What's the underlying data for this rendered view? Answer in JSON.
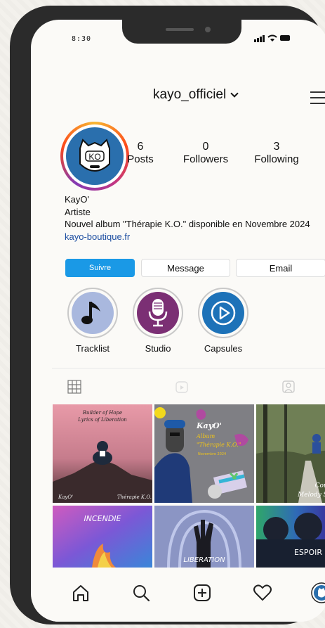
{
  "status_bar": {
    "time": "8:30"
  },
  "header": {
    "username": "kayo_officiel",
    "dropdown_icon": "chevron-down-icon",
    "menu_icon": "hamburger-menu-icon"
  },
  "profile": {
    "avatar_text": "KO",
    "stats": [
      {
        "value": "6",
        "label": "Posts"
      },
      {
        "value": "0",
        "label": "Followers"
      },
      {
        "value": "3",
        "label": "Following"
      }
    ],
    "name": "KayO'",
    "category": "Artiste",
    "bio": "Nouvel album \"Thérapie K.O.\" disponible en Novembre 2024",
    "link": "kayo-boutique.fr"
  },
  "actions": {
    "follow": "Suivre",
    "message": "Message",
    "email": "Email",
    "more_icon": "chevron-down-icon"
  },
  "highlights": [
    {
      "label": "Tracklist",
      "icon": "music-note-icon",
      "color": "#a9b8de"
    },
    {
      "label": "Studio",
      "icon": "microphone-icon",
      "color": "#7b2f74"
    },
    {
      "label": "Capsules",
      "icon": "play-icon",
      "color": "#1d72b8"
    }
  ],
  "tabs": [
    {
      "name": "grid",
      "icon": "grid-icon"
    },
    {
      "name": "reels",
      "icon": "reels-icon"
    },
    {
      "name": "tagged",
      "icon": "tagged-icon"
    }
  ],
  "posts": {
    "p1": {
      "line1": "Builder of Hope",
      "line2": "Lyrics of Liberation",
      "left": "KayO'",
      "right": "Thérapie K.O."
    },
    "p2": {
      "line1": "KayO'",
      "line2": "Album",
      "line3": "\"Thérapie K.O.\"",
      "line4": "Novembre 2024"
    },
    "p3": {
      "line1": "Courage in",
      "line2": "Melody Strength"
    },
    "p4": {
      "title": "INCENDIE"
    },
    "p5": {
      "title": "LIBERATION"
    },
    "p6": {
      "title": "ESPOIR"
    }
  },
  "bottom_nav": [
    "home-icon",
    "search-icon",
    "add-post-icon",
    "heart-icon",
    "profile-avatar-icon"
  ],
  "colors": {
    "accent": "#1a99e6",
    "link": "#1d4ea1",
    "frame": "#2b2b2b"
  }
}
